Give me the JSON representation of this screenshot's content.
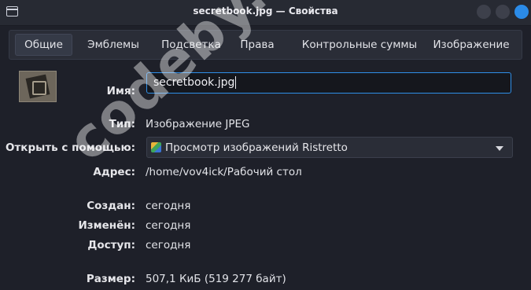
{
  "window": {
    "title": "secretbook.jpg — Свойства"
  },
  "tabs": [
    "Общие",
    "Эмблемы",
    "Подсветка",
    "Права",
    "Контрольные суммы",
    "Изображение"
  ],
  "form": {
    "name_label": "Имя:",
    "name_value": "secretbook.jpg",
    "type_label": "Тип:",
    "type_value": "Изображение JPEG",
    "open_with_label": "Открыть с помощью:",
    "open_with_value": "Просмотр изображений Ristretto",
    "address_label": "Адрес:",
    "address_value": "/home/vov4ick/Рабочий стол",
    "created_label": "Создан:",
    "created_value": "сегодня",
    "modified_label": "Изменён:",
    "modified_value": "сегодня",
    "accessed_label": "Доступ:",
    "accessed_value": "сегодня",
    "size_label": "Размер:",
    "size_value": "507,1 КиБ (519 277 байт)"
  },
  "watermark": "codeby.net",
  "colors": {
    "accent": "#2f8fe8",
    "background": "#1e2029",
    "close_button": "#2b8be8"
  }
}
